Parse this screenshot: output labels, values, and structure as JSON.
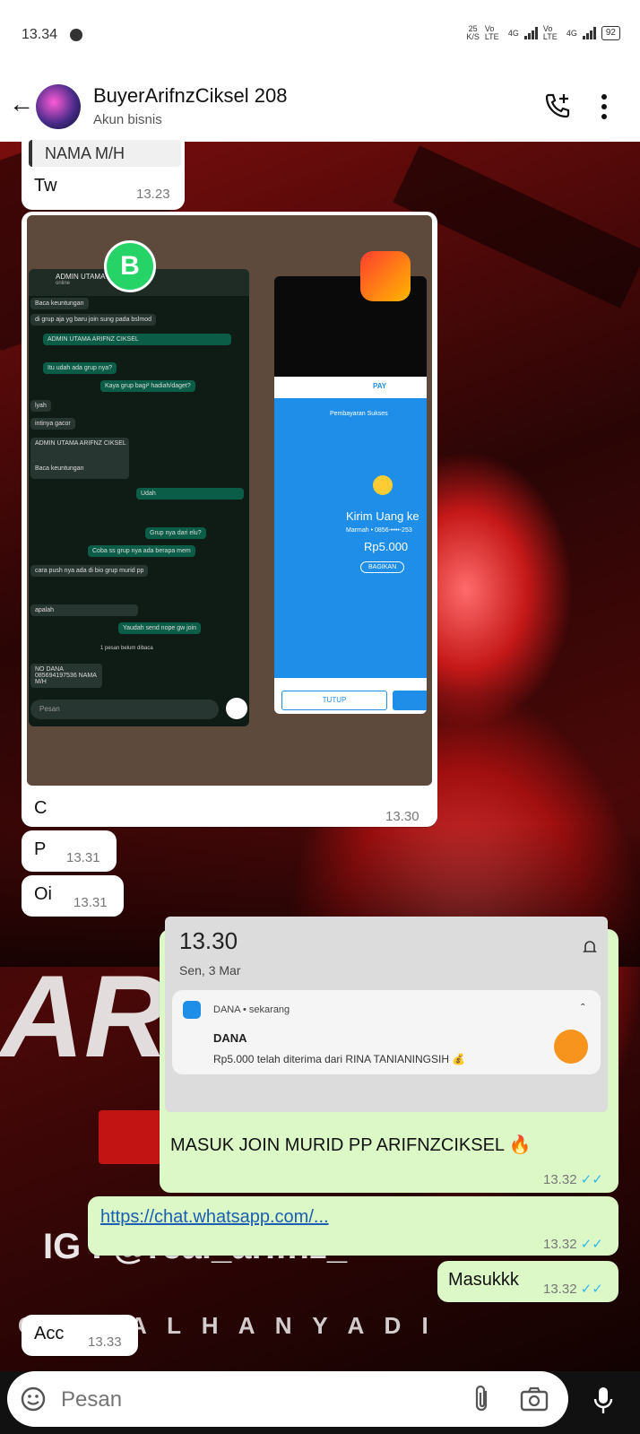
{
  "status_bar": {
    "time": "13.34",
    "net_speed_top": "25",
    "net_speed_bottom": "K/S",
    "sim1_tag": "Vo LTE",
    "sim1_gen": "4G",
    "sim2_tag": "Vo LTE",
    "sim2_gen": "4G",
    "battery": "92"
  },
  "header": {
    "contact_name": "BuyerArifnzCiksel 208",
    "contact_sub": "Akun bisnis"
  },
  "messages": {
    "m1_quote": "NAMA M/H",
    "m1_text": "Tw",
    "m1_time": "13.23",
    "img_caption": "C",
    "img_time": "13.30",
    "m2_text": "P",
    "m2_time": "13.31",
    "m3_text": "Oi",
    "m3_time": "13.31",
    "m4_caption": "MASUK JOIN MURID PP ARIFNZCIKSEL 🔥",
    "m4_time": "13.32",
    "m5_link": "https://chat.whatsapp.com/...",
    "m5_time": "13.32",
    "m6_text": "Masukkk",
    "m6_time": "13.32",
    "m7_text": "Acc",
    "m7_time": "13.33"
  },
  "embedded_chat": {
    "title": "ADMIN UTAMA",
    "subtitle": "online",
    "lines": [
      {
        "dir": "in",
        "text": "Baca keuntungan"
      },
      {
        "dir": "in",
        "text": "di grup aja yg baru join sung pada bslmod"
      },
      {
        "dir": "out",
        "text": "ADMIN UTAMA ARIFNZ CIKSEL"
      },
      {
        "dir": "out",
        "text": "Itu udah ada grup nya?"
      },
      {
        "dir": "out",
        "text": "Kaya grup bagi² hadiah/daget?"
      },
      {
        "dir": "in",
        "text": "lyah"
      },
      {
        "dir": "in",
        "text": "intinya gacor"
      },
      {
        "dir": "in",
        "text": "ADMIN UTAMA ARIFNZ CIKSEL"
      },
      {
        "dir": "in",
        "text": "Baca keuntungan"
      },
      {
        "dir": "out",
        "text": "Udah"
      },
      {
        "dir": "out",
        "text": "Grup nya dari elu?"
      },
      {
        "dir": "out",
        "text": "Coba ss grup nya ada berapa mem"
      },
      {
        "dir": "in",
        "text": "cara push nya ada di bio grup murid pp"
      },
      {
        "dir": "in",
        "text": "apalah"
      },
      {
        "dir": "out",
        "text": "Yaudah send nope gw join"
      },
      {
        "dir": "in",
        "text": "NO DANA 085694197536 NAMA M/H"
      }
    ],
    "unread": "1 pesan belum dibaca",
    "input_placeholder": "Pesan"
  },
  "embedded_payment": {
    "brand": "PAY",
    "status": "Pembayaran Sukses",
    "title": "Kirim Uang ke",
    "recipient": "Marmah • 0856-••••-253",
    "amount": "Rp5.000",
    "share": "BAGIKAN",
    "close": "TUTUP"
  },
  "notification": {
    "time": "13.30",
    "date": "Sen, 3 Mar",
    "app": "DANA • sekarang",
    "title": "DANA",
    "body": "Rp5.000 telah diterima dari RINA TANIANINGSIH 💰"
  },
  "watermark": {
    "ig": "IG : @real_arifnz_",
    "bottom": "O R E A L   H A N Y A   D I"
  },
  "input": {
    "placeholder": "Pesan"
  }
}
